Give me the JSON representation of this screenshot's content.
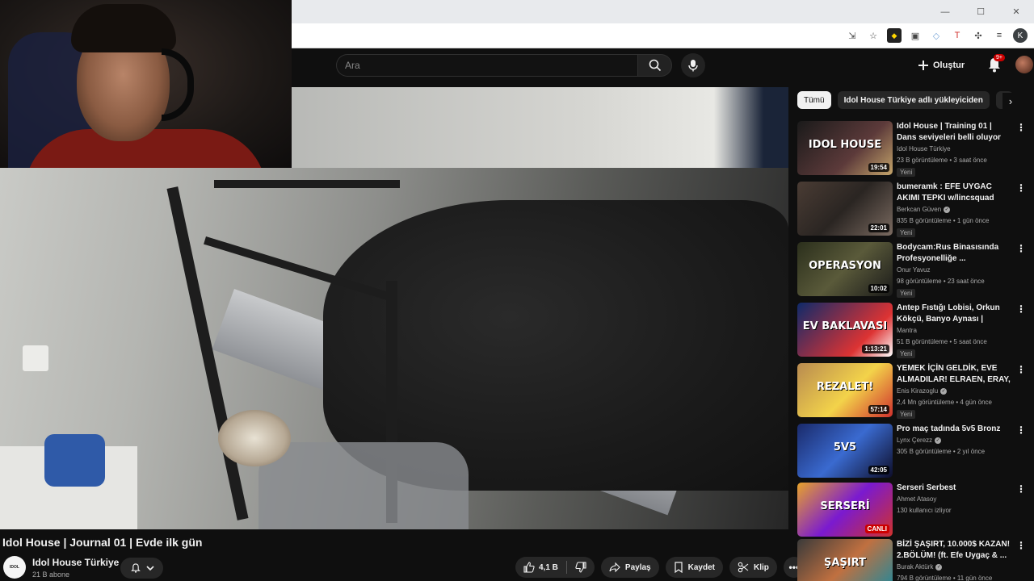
{
  "browser": {
    "profile_initial": "K"
  },
  "masthead": {
    "search_placeholder": "Ara",
    "create_label": "Oluştur",
    "notif_badge": "9+"
  },
  "video": {
    "title": "Idol House | Journal 01 | Evde ilk gün",
    "channel": "Idol House Türkiye",
    "subscribers": "21 B abone",
    "likes": "4,1 B",
    "share_label": "Paylaş",
    "save_label": "Kaydet",
    "clip_label": "Klip"
  },
  "chips": [
    {
      "label": "Tümü"
    },
    {
      "label": "Idol House Türkiye adlı yükleyiciden"
    },
    {
      "label": "İl"
    }
  ],
  "recommendations": [
    {
      "title": "Idol House | Training 01 | Dans seviyeleri belli oluyor",
      "channel": "Idol House Türkiye",
      "meta": "23 B görüntüleme • 3 saat önce",
      "badge": "Yeni",
      "duration": "19:54",
      "thumb_text": "IDOL HOUSE",
      "verified": false
    },
    {
      "title": "bumeramk : EFE UYGAC AKIMI TEPKI w/lincsquad",
      "channel": "Berkcan Güven",
      "meta": "835 B görüntüleme • 1 gün önce",
      "badge": "Yeni",
      "duration": "22:01",
      "thumb_text": "",
      "verified": true
    },
    {
      "title": "Bodycam:Rus Binasısında Profesyonelliğe ...",
      "channel": "Onur Yavuz",
      "meta": "98 görüntüleme • 23 saat önce",
      "badge": "Yeni",
      "duration": "10:02",
      "thumb_text": "OPERASYON",
      "verified": false
    },
    {
      "title": "Antep Fıstığı Lobisi, Orkun Kökçü, Banyo Aynası | Harman...",
      "channel": "Mantra",
      "meta": "51 B görüntüleme • 5 saat önce",
      "badge": "Yeni",
      "duration": "1:13:21",
      "thumb_text": "EV BAKLAVASI",
      "verified": false
    },
    {
      "title": "YEMEK İÇİN GELDİK, EVE ALMADILAR! ELRAEN, ERAY, ...",
      "channel": "Enis Kirazoglu",
      "meta": "2,4 Mn görüntüleme • 4 gün önce",
      "badge": "Yeni",
      "duration": "57:14",
      "thumb_text": "REZALET!",
      "verified": true
    },
    {
      "title": "Pro maç tadında 5v5 Bronz",
      "channel": "Lynx Çerezz",
      "meta": "305 B görüntüleme • 2 yıl önce",
      "badge": "",
      "duration": "42:05",
      "thumb_text": "5V5",
      "verified": true
    },
    {
      "title": "Serseri Serbest",
      "channel": "Ahmet Atasoy",
      "meta": "130 kullanıcı izliyor",
      "badge": "",
      "duration": "",
      "live": "CANLI",
      "thumb_text": "SERSERİ",
      "verified": false
    },
    {
      "title": "BİZİ ŞAŞIRT, 10.000$ KAZAN! 2.BÖLÜM! (ft. Efe Uygaç & ...",
      "channel": "Burak Aktürk",
      "meta": "794 B görüntüleme • 11 gün önce",
      "badge": "",
      "duration": "",
      "thumb_text": "ŞAŞIRT",
      "verified": true
    }
  ],
  "colors": {
    "bg": "#0f0f0f",
    "surface": "#272727",
    "text": "#f1f1f1",
    "muted": "#aaaaaa",
    "accent_red": "#cc0000"
  }
}
